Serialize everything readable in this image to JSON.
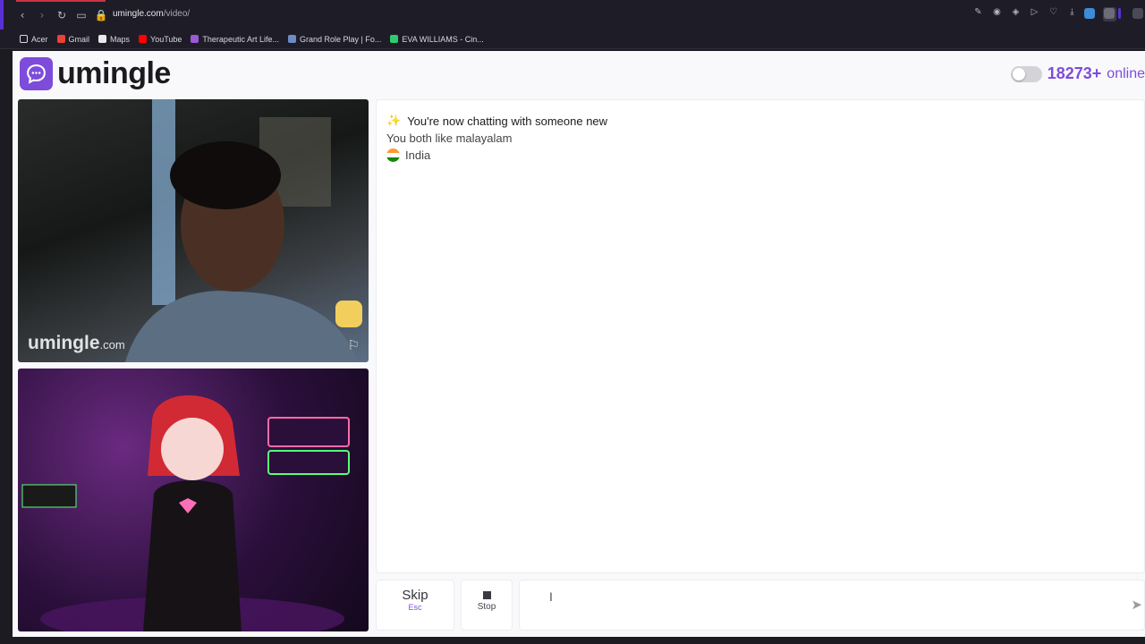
{
  "browser": {
    "url_host": "umingle.com",
    "url_path": "/video/",
    "bookmarks": [
      {
        "label": "Acer",
        "color": "#e8e8ee"
      },
      {
        "label": "Gmail",
        "color": "#ea4335"
      },
      {
        "label": "Maps",
        "color": "#e8e8ee"
      },
      {
        "label": "YouTube",
        "color": "#ff0000"
      },
      {
        "label": "Therapeutic Art Life...",
        "color": "#9b59d6"
      },
      {
        "label": "Grand Role Play | Fo...",
        "color": "#6b8cc7"
      },
      {
        "label": "EVA WILLIAMS - Cin...",
        "color": "#2ecc71"
      }
    ]
  },
  "header": {
    "logo_text": "umingle",
    "online_count": "18273+",
    "online_label": "online"
  },
  "video_remote": {
    "watermark_main": "umingle",
    "watermark_suffix": ".com"
  },
  "chat": {
    "intro_icon": "sparkles",
    "intro": "You're now chatting with someone new",
    "common": "You both like malayalam",
    "country": "India"
  },
  "controls": {
    "skip_label": "Skip",
    "skip_hint": "Esc",
    "stop_label": "Stop",
    "message_value": ""
  },
  "colors": {
    "brand": "#7d4cdb"
  }
}
